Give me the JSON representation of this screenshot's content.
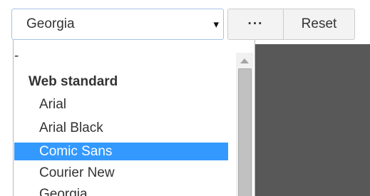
{
  "font_select": {
    "value": "Georgia",
    "arrow": "▾",
    "arrow_icon": "caret-down-icon"
  },
  "toolbar": {
    "more_label": "···",
    "reset_label": "Reset"
  },
  "dropdown": {
    "blank_option": "-",
    "group_label": "Web standard",
    "options": [
      "Arial",
      "Arial Black",
      "Comic Sans",
      "Courier New",
      "Georgia"
    ],
    "selected": "Comic Sans",
    "highlight_color": "#3399ff"
  }
}
